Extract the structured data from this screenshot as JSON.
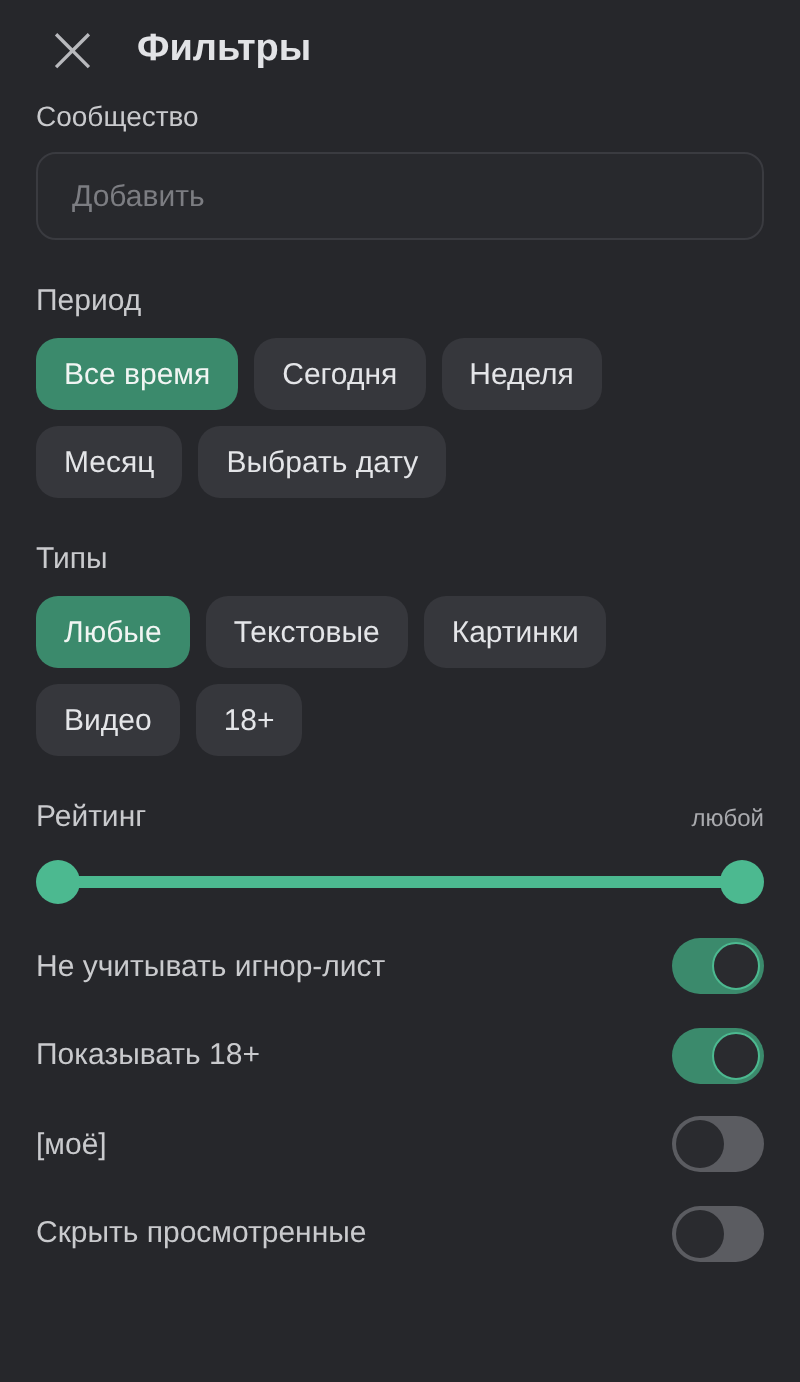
{
  "header": {
    "close": "×",
    "title": "Фильтры"
  },
  "community": {
    "label": "Сообщество",
    "placeholder": "Добавить"
  },
  "period": {
    "label": "Период",
    "chips": [
      {
        "label": "Все время",
        "selected": true
      },
      {
        "label": "Сегодня",
        "selected": false
      },
      {
        "label": "Неделя",
        "selected": false
      },
      {
        "label": "Месяц",
        "selected": false
      },
      {
        "label": "Выбрать дату",
        "selected": false
      }
    ]
  },
  "types": {
    "label": "Типы",
    "chips": [
      {
        "label": "Любые",
        "selected": true
      },
      {
        "label": "Текстовые",
        "selected": false
      },
      {
        "label": "Картинки",
        "selected": false
      },
      {
        "label": "Видео",
        "selected": false
      },
      {
        "label": "18+",
        "selected": false
      }
    ]
  },
  "rating": {
    "label": "Рейтинг",
    "reading": "любой",
    "thumbs": [
      {
        "level": 0
      },
      {
        "level": 1
      }
    ]
  },
  "toggles": [
    {
      "label": "Не учитывать игнор-лист",
      "on": true
    },
    {
      "label": "Показывать 18+",
      "on": true
    },
    {
      "label": "[моё]",
      "on": false
    },
    {
      "label": "Скрыть просмотренные",
      "on": false
    }
  ]
}
